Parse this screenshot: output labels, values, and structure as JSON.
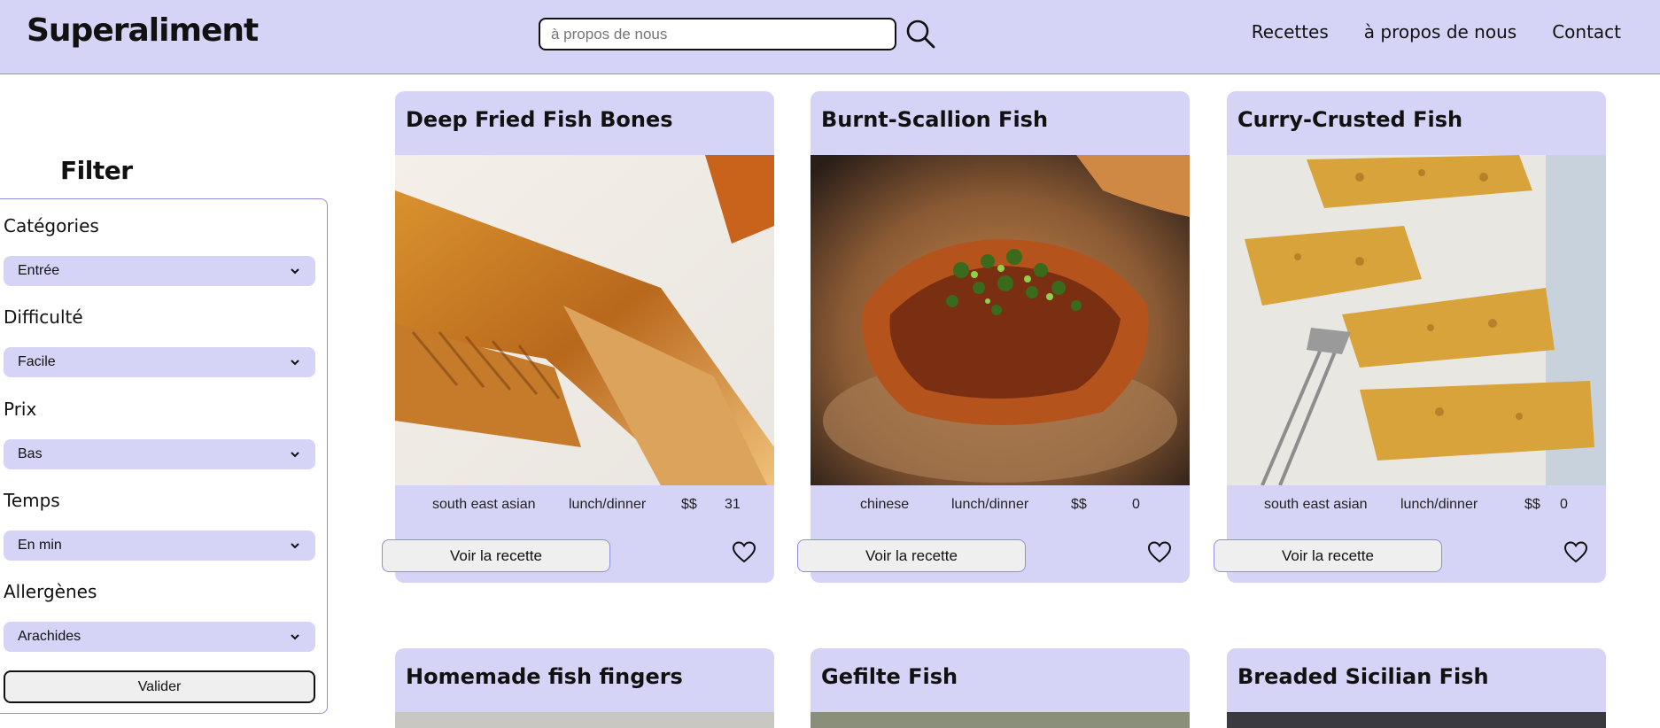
{
  "header": {
    "brand": "Superaliment",
    "search": {
      "value": "",
      "placeholder": "à propos de nous"
    },
    "nav": [
      "Recettes",
      "à propos de nous",
      "Contact"
    ]
  },
  "filters": {
    "title": "Filter",
    "groups": [
      {
        "label": "Catégories",
        "selected": "Entrée"
      },
      {
        "label": "Difficulté",
        "selected": "Facile"
      },
      {
        "label": "Prix",
        "selected": "Bas"
      },
      {
        "label": "Temps",
        "selected": "En min"
      },
      {
        "label": "Allergènes",
        "selected": "Arachides"
      }
    ],
    "submit_label": "Valider"
  },
  "recipes": [
    {
      "title": "Deep Fried Fish Bones",
      "cuisine": "south east asian",
      "meal": "lunch/dinner",
      "price": "$$",
      "count": "31",
      "button_label": "Voir la recette"
    },
    {
      "title": "Burnt-Scallion Fish",
      "cuisine": "chinese",
      "meal": "lunch/dinner",
      "price": "$$",
      "count": "0",
      "button_label": "Voir la recette"
    },
    {
      "title": "Curry-Crusted Fish",
      "cuisine": "south east asian",
      "meal": "lunch/dinner",
      "price": "$$",
      "count": "0",
      "button_label": "Voir la recette"
    },
    {
      "title": "Homemade fish fingers"
    },
    {
      "title": "Gefilte Fish"
    },
    {
      "title": "Breaded Sicilian Fish"
    }
  ],
  "colors": {
    "accent": "#d5d4f7",
    "border": "#8f8de0"
  }
}
